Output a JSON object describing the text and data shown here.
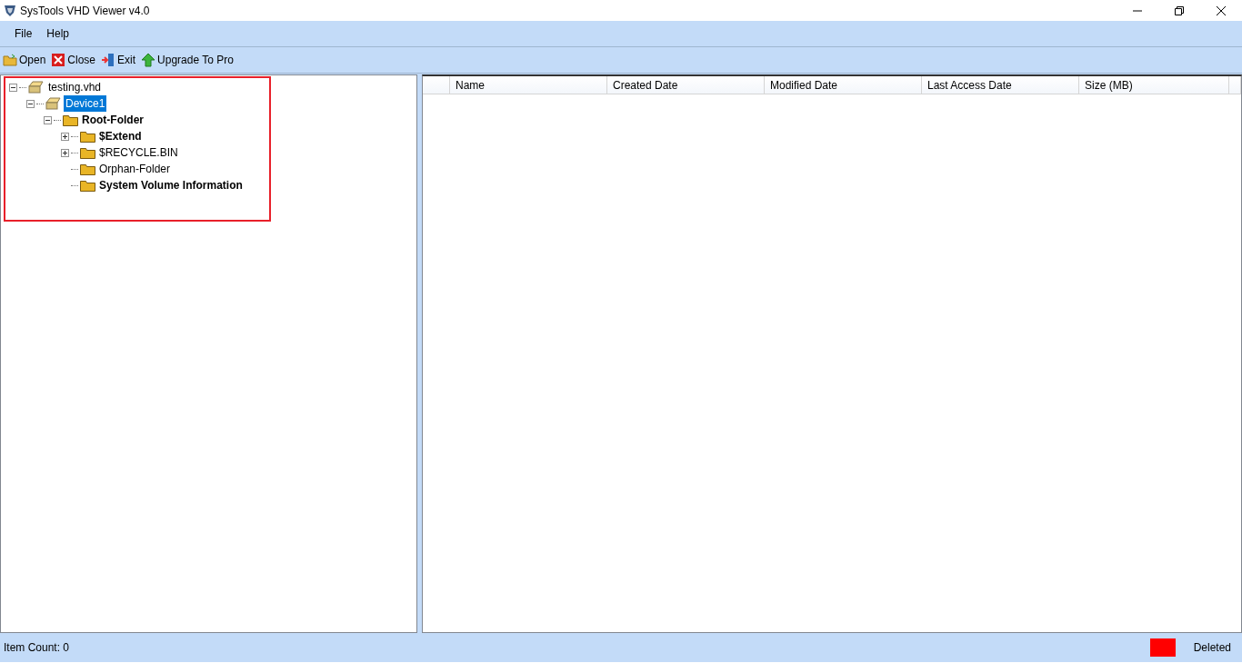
{
  "window": {
    "title": "SysTools VHD Viewer v4.0"
  },
  "menu": [
    "File",
    "Help"
  ],
  "toolbar": [
    {
      "label": "Open",
      "kind": "open"
    },
    {
      "label": "Close",
      "kind": "close"
    },
    {
      "label": "Exit",
      "kind": "exit"
    },
    {
      "label": "Upgrade To Pro",
      "kind": "upgrade"
    }
  ],
  "tree": [
    {
      "label": "testing.vhd",
      "kind": "drive",
      "bold": false,
      "selected": false,
      "expanded": true,
      "children": [
        {
          "label": "Device1",
          "kind": "drive",
          "bold": false,
          "selected": true,
          "expanded": true,
          "children": [
            {
              "label": "Root-Folder",
              "kind": "folder",
              "bold": true,
              "selected": false,
              "expanded": true,
              "children": [
                {
                  "label": "$Extend",
                  "kind": "folder",
                  "bold": true,
                  "selected": false,
                  "expanded": false
                },
                {
                  "label": "$RECYCLE.BIN",
                  "kind": "folder",
                  "bold": false,
                  "selected": false,
                  "expanded": false
                },
                {
                  "label": "Orphan-Folder",
                  "kind": "folder",
                  "bold": false,
                  "selected": false
                },
                {
                  "label": "System Volume Information",
                  "kind": "folder",
                  "bold": true,
                  "selected": false
                }
              ]
            }
          ]
        }
      ]
    }
  ],
  "table": {
    "columns": [
      "Name",
      "Created Date",
      "Modified Date",
      "Last Access Date",
      "Size (MB)"
    ]
  },
  "status_bar": {
    "item_count": "Item Count: 0",
    "legend": [
      {
        "label": "Deleted",
        "color": "#ff0000"
      }
    ]
  }
}
